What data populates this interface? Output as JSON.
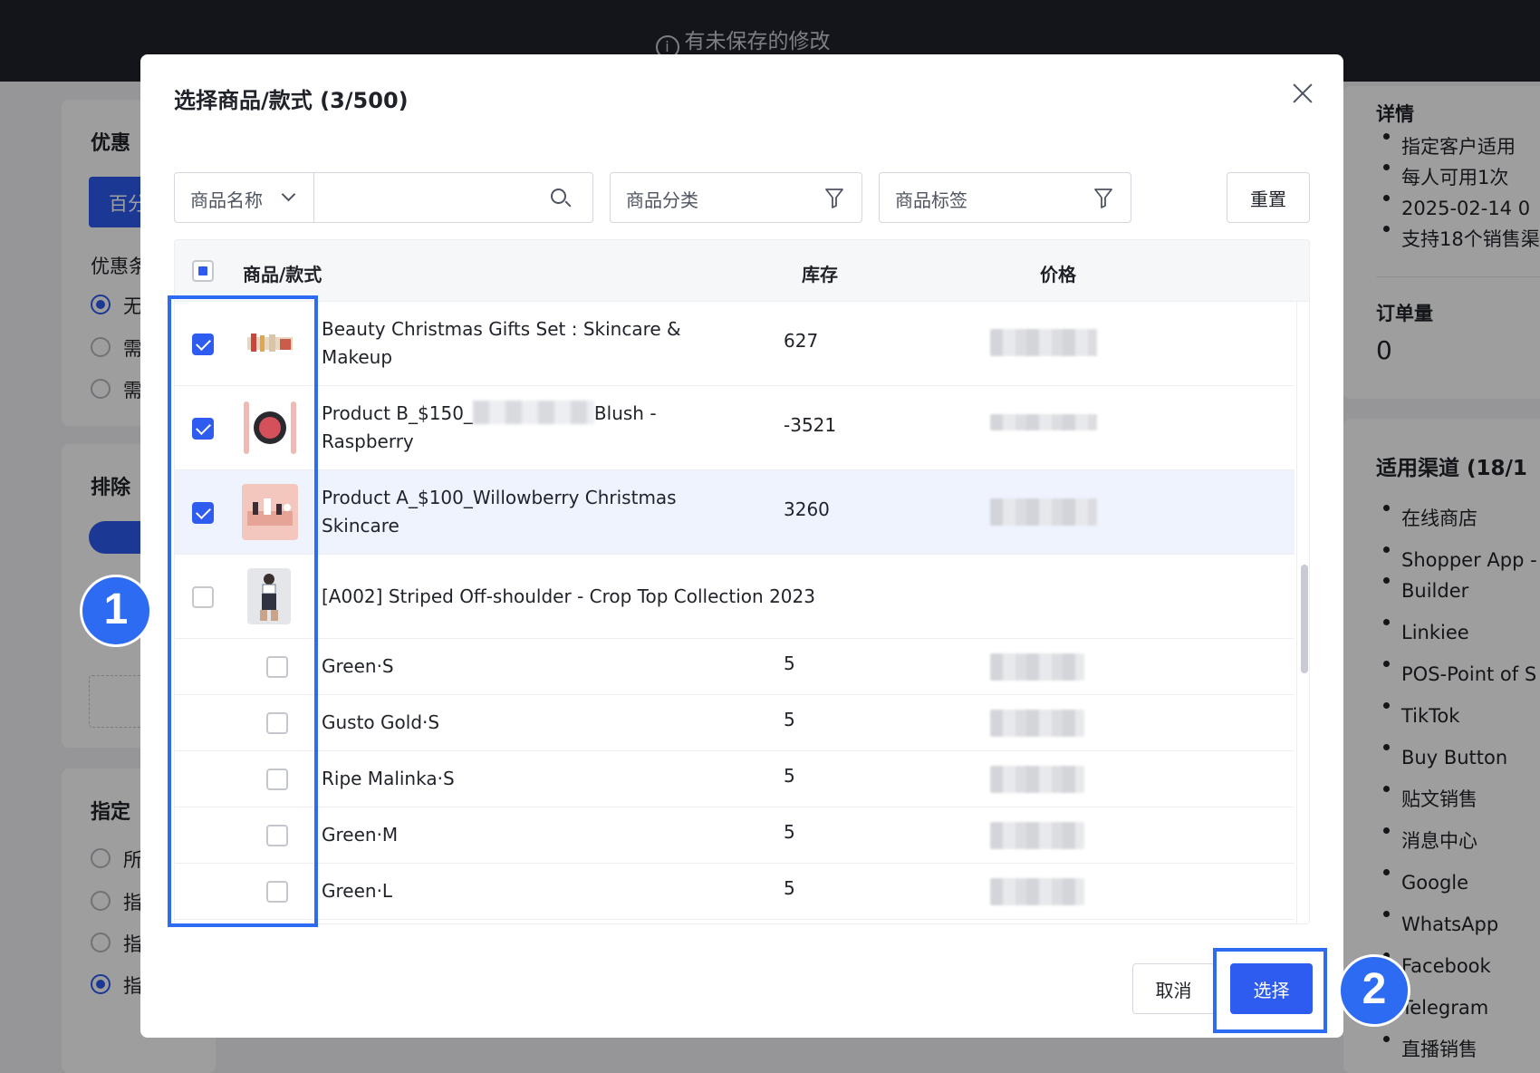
{
  "topbar": {
    "notice": "有未保存的修改"
  },
  "background": {
    "card1": {
      "title_fragment": "优惠",
      "tab_fragment": "百分",
      "section_fragment": "优惠条",
      "radio_fragments": [
        "无",
        "需",
        "需"
      ]
    },
    "card2": {
      "title_fragment": "排除"
    },
    "card3": {
      "title_fragment": "指定",
      "radio_fragments": [
        "所",
        "指",
        "指",
        "指"
      ]
    },
    "right": {
      "details_heading": "详情",
      "details_items": [
        "指定客户适用",
        "每人可用1次",
        "2025-02-14 0",
        "支持18个销售渠"
      ],
      "orders_heading": "订单量",
      "orders_value": "0",
      "channels_heading": "适用渠道 (18/1",
      "channels": [
        "在线商店",
        "Shopper App -",
        "Builder",
        "Linkiee",
        "POS-Point of S",
        "TikTok",
        "Buy Button",
        "贴文销售",
        "消息中心",
        "Google",
        "WhatsApp",
        "Facebook",
        "Telegram",
        "直播销售"
      ]
    }
  },
  "modal": {
    "title": "选择商品/款式 (3/500)",
    "filters": {
      "name_select_label": "商品名称",
      "search_placeholder": "",
      "category_label": "商品分类",
      "tag_label": "商品标签",
      "reset_label": "重置"
    },
    "table": {
      "headers": {
        "product": "商品/款式",
        "stock": "库存",
        "price": "价格"
      },
      "rows": [
        {
          "name": "Beauty Christmas Gifts Set : Skincare & Makeup",
          "stock": "627",
          "checked": true
        },
        {
          "name_start": "Product B_$150_",
          "name_end": "Blush - Raspberry",
          "stock": "-3521",
          "checked": true
        },
        {
          "name": "Product A_$100_Willowberry Christmas Skincare",
          "stock": "3260",
          "checked": true
        },
        {
          "name": "[A002] Striped Off-shoulder - Crop Top Collection 2023",
          "stock": "",
          "checked": false
        },
        {
          "name": "Green·S",
          "stock": "5",
          "checked": false
        },
        {
          "name": "Gusto Gold·S",
          "stock": "5",
          "checked": false
        },
        {
          "name": "Ripe Malinka·S",
          "stock": "5",
          "checked": false
        },
        {
          "name": "Green·M",
          "stock": "5",
          "checked": false
        },
        {
          "name": "Green·L",
          "stock": "5",
          "checked": false
        }
      ]
    },
    "cancel_label": "取消",
    "select_label": "选择"
  },
  "annotations": {
    "step1": "1",
    "step2": "2"
  },
  "colors": {
    "accent": "#2e5bf0",
    "annotation": "#2e6bf3",
    "topbar": "#20232d"
  }
}
